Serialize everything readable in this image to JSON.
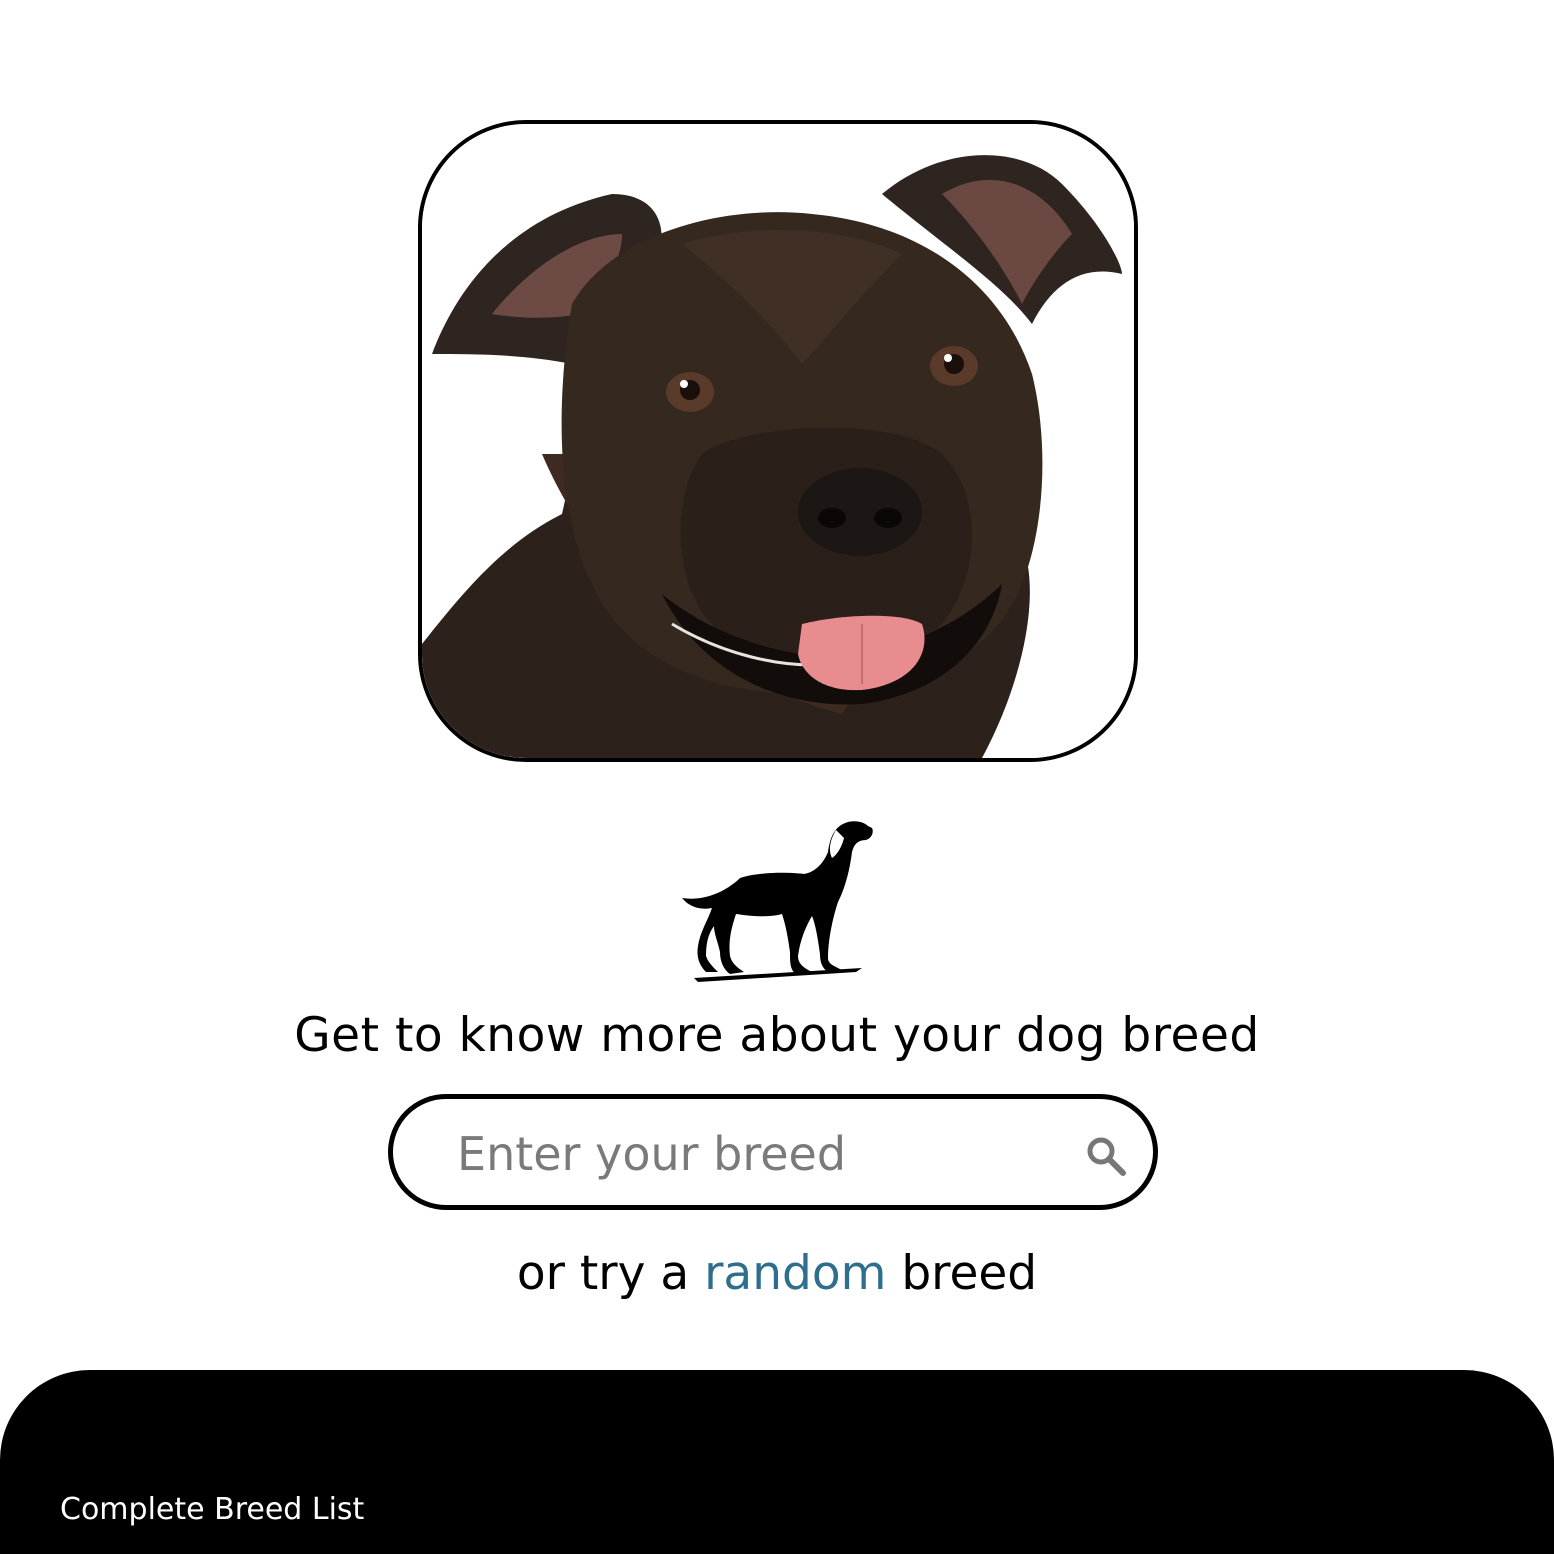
{
  "hero": {
    "image_alt": "Brown Staffordshire bull terrier portrait"
  },
  "logo": {
    "icon": "dog-silhouette-icon"
  },
  "tagline": "Get to know more about your dog breed",
  "search": {
    "placeholder": "Enter your breed",
    "value": "",
    "icon": "search-icon"
  },
  "random": {
    "prefix": "or try a ",
    "link": "random",
    "suffix": " breed"
  },
  "footer": {
    "link": "Complete Breed List"
  },
  "colors": {
    "link_accent": "#2e6f8e",
    "footer_bg": "#000000",
    "placeholder": "#7a7a7a"
  }
}
